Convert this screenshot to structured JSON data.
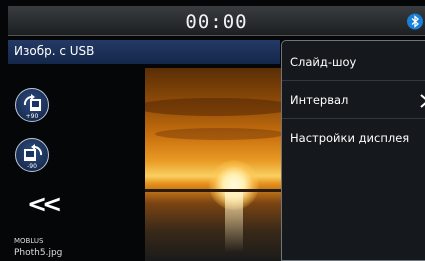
{
  "status_bar": {
    "time": "00:00",
    "bluetooth_icon": "bluetooth-icon"
  },
  "header": {
    "title": "Изобр. с USB"
  },
  "controls": {
    "rotate_cw_label": "+90",
    "rotate_ccw_label": "-90",
    "rotate_cw_icon": "rotate-clockwise-icon",
    "rotate_ccw_icon": "rotate-counterclockwise-icon",
    "previous_icon": "previous-icon"
  },
  "file": {
    "folder": "MOBLUS",
    "name": "Photh5.jpg"
  },
  "menu": {
    "items": [
      {
        "label": "Слайд-шоу"
      },
      {
        "label": "Интервал"
      },
      {
        "label": "Настройки дисплея"
      }
    ]
  }
}
